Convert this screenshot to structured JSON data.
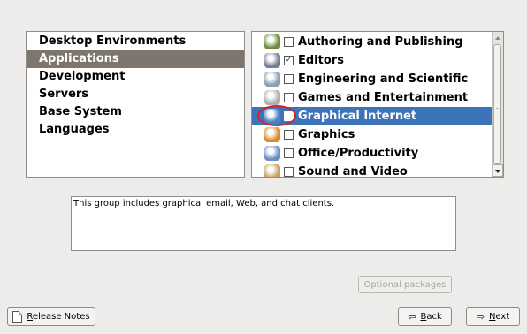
{
  "categories": [
    {
      "label": "Desktop Environments",
      "selected": false
    },
    {
      "label": "Applications",
      "selected": true
    },
    {
      "label": "Development",
      "selected": false
    },
    {
      "label": "Servers",
      "selected": false
    },
    {
      "label": "Base System",
      "selected": false
    },
    {
      "label": "Languages",
      "selected": false
    }
  ],
  "groups": [
    {
      "label": "Authoring and Publishing",
      "icon": "authoring-icon",
      "checked": false,
      "selected": false,
      "icon_color": "#6a8f3c"
    },
    {
      "label": "Editors",
      "icon": "editors-icon",
      "checked": true,
      "selected": false,
      "icon_color": "#7c7c9a"
    },
    {
      "label": "Engineering and Scientific",
      "icon": "engineering-icon",
      "checked": false,
      "selected": false,
      "icon_color": "#8aa0b0"
    },
    {
      "label": "Games and Entertainment",
      "icon": "games-icon",
      "checked": false,
      "selected": false,
      "icon_color": "#b0b0b0"
    },
    {
      "label": "Graphical Internet",
      "icon": "internet-globe-icon",
      "checked": false,
      "selected": true,
      "icon_color": "#4a7fc1"
    },
    {
      "label": "Graphics",
      "icon": "graphics-icon",
      "checked": false,
      "selected": false,
      "icon_color": "#d98b2b"
    },
    {
      "label": "Office/Productivity",
      "icon": "office-icon",
      "checked": false,
      "selected": false,
      "icon_color": "#6d8fbf"
    },
    {
      "label": "Sound and Video",
      "icon": "sound-video-icon",
      "checked": false,
      "selected": false,
      "icon_color": "#c8a25a"
    }
  ],
  "description": "This group includes graphical email, Web, and chat clients.",
  "buttons": {
    "optional_packages": "Optional packages",
    "release_notes_mnemonic": "R",
    "release_notes_rest": "elease Notes",
    "back_mnemonic": "B",
    "back_rest": "ack",
    "next_mnemonic": "N",
    "next_rest": "ext"
  },
  "colors": {
    "selected_row": "#3d73b8",
    "selected_category": "#7e766c",
    "highlight_ellipse": "#d42525"
  }
}
